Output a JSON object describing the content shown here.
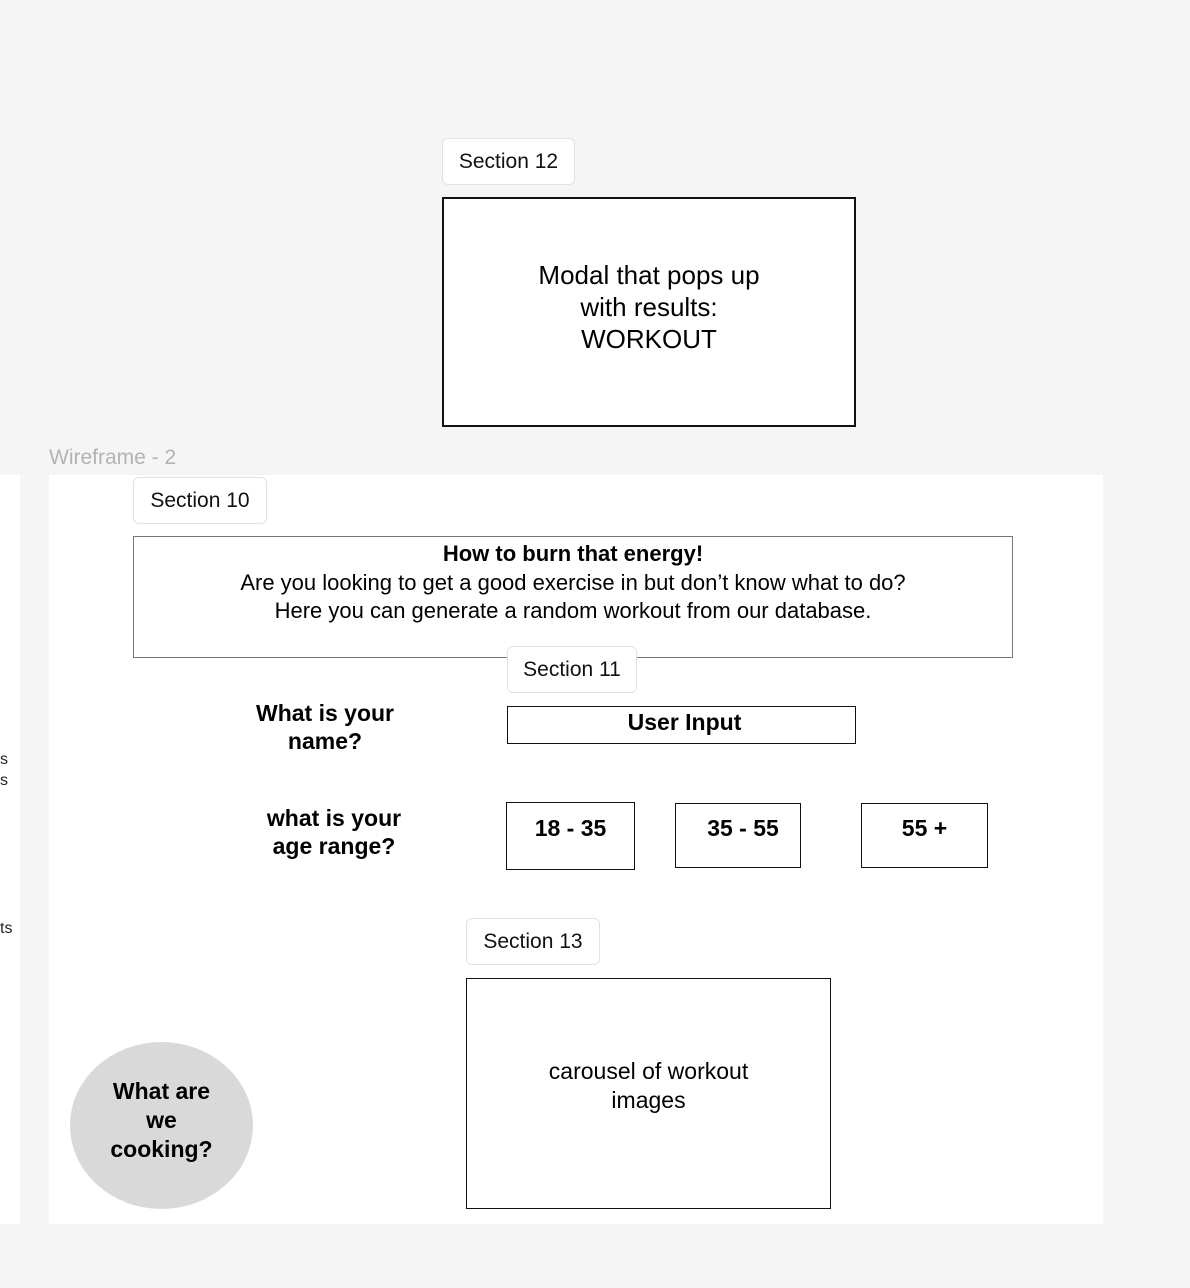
{
  "section12": {
    "tag": "Section 12",
    "modal_text": "Modal that pops up\nwith results:\nWORKOUT"
  },
  "wireframe": {
    "label": "Wireframe - 2"
  },
  "left_frame": {
    "edge_text_1": "s\ns",
    "edge_text_2": "ts"
  },
  "section10": {
    "tag": "Section 10",
    "heading": "How to burn that energy!",
    "line1": "Are you looking to get a good exercise in but don’t know what to do?",
    "line2": "Here you can generate a random workout from our database."
  },
  "section11": {
    "tag": "Section 11",
    "name_question": "What is your\nname?",
    "name_input_label": "User Input",
    "age_question": "what is your\nage range?",
    "age_options": [
      "18 - 35",
      "35 - 55",
      "55 +"
    ]
  },
  "section13": {
    "tag": "Section 13",
    "carousel_text": "carousel of workout\nimages"
  },
  "cooking_button": {
    "label": "What are\nwe\ncooking?"
  },
  "colors": {
    "canvas": "#f5f5f5",
    "frame": "#ffffff",
    "circle": "#d9d9d9",
    "label_gray": "#b3b3b3"
  }
}
